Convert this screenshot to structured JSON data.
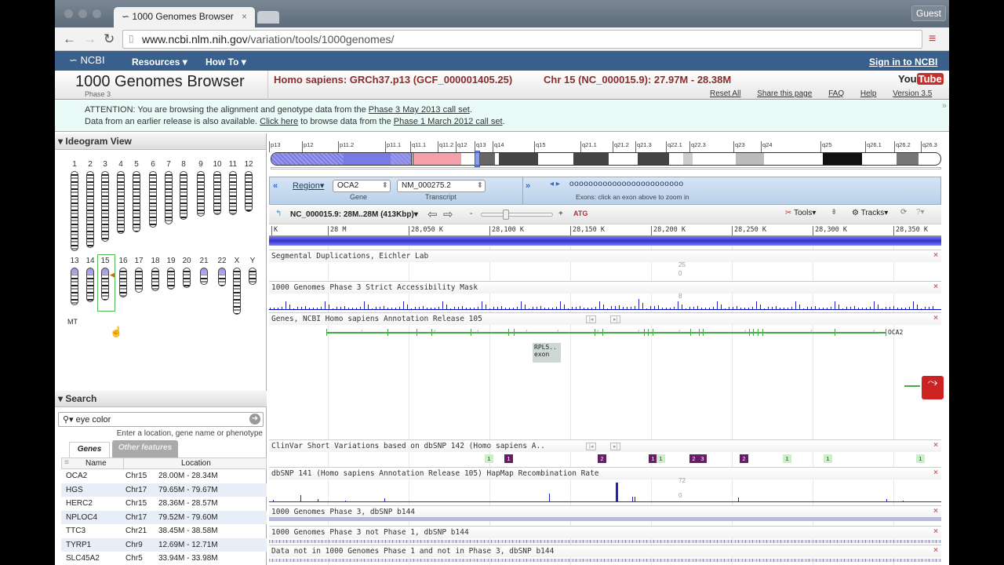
{
  "browser": {
    "tab_title": "1000 Genomes Browser",
    "url_host": "www.ncbi.nlm.nih.gov",
    "url_path": "/variation/tools/1000genomes/",
    "guest": "Guest"
  },
  "ncbi": {
    "logo": "NCBI",
    "resources": "Resources",
    "howto": "How To",
    "signin": "Sign in to NCBI"
  },
  "header": {
    "title": "1000 Genomes Browser",
    "subtitle": "Phase 3",
    "assembly": "Homo sapiens: GRCh37.p13 (GCF_000001405.25)",
    "region": "Chr 15 (NC_000015.9): 27.97M - 28.38M",
    "youtube": "YouTube",
    "links": [
      "Reset All",
      "Share this page",
      "FAQ",
      "Help",
      "Version 3.5"
    ]
  },
  "attention": {
    "l1a": "ATTENTION: You are browsing the alignment and genotype data from the ",
    "l1link": "Phase 3 May 2013 call set",
    "l1b": ".",
    "l2a": "Data from an earlier release is also available. ",
    "l2link1": "Click here",
    "l2b": " to browse data from the ",
    "l2link2": "Phase 1 March 2012 call set",
    "l2c": "."
  },
  "ideogram": {
    "title": "Ideogram View",
    "row1": [
      "1",
      "2",
      "3",
      "4",
      "5",
      "6",
      "7",
      "8",
      "9",
      "10",
      "11",
      "12"
    ],
    "row2": [
      "13",
      "14",
      "15",
      "16",
      "17",
      "18",
      "19",
      "20",
      "21",
      "22",
      "X",
      "Y"
    ],
    "mt": "MT",
    "selected": "15"
  },
  "search": {
    "title": "Search",
    "value": "eye color",
    "hint": "Enter a location, gene name or phenotype",
    "tabs": [
      "Genes",
      "Other features"
    ],
    "columns": [
      "Name",
      "Location"
    ],
    "rows": [
      [
        "OCA2",
        "Chr15",
        "28.00M - 28.34M"
      ],
      [
        "HGS",
        "Chr17",
        "79.65M - 79.67M"
      ],
      [
        "HERC2",
        "Chr15",
        "28.36M - 28.57M"
      ],
      [
        "NPLOC4",
        "Chr17",
        "79.52M - 79.60M"
      ],
      [
        "TTC3",
        "Chr21",
        "38.45M - 38.58M"
      ],
      [
        "TYRP1",
        "Chr9",
        "12.69M - 12.71M"
      ],
      [
        "SLC45A2",
        "Chr5",
        "33.94M - 33.98M"
      ]
    ]
  },
  "cytobands": [
    "p13",
    "p12",
    "p11.2",
    "p11.1",
    "q11.1",
    "q11.2",
    "q12",
    "q13",
    "q14",
    "q15",
    "q21.1",
    "q21.2",
    "q21.3",
    "q22.1",
    "q22.3",
    "q23",
    "q24",
    "q25",
    "q26.1",
    "q26.2",
    "q26.3"
  ],
  "region": {
    "mode": "Region",
    "gene": "OCA2",
    "gene_label": "Gene",
    "transcript": "NM_000275.2",
    "transcript_label": "Transcript",
    "exons_hint": "Exons: click an exon above to zoom in",
    "exon_count": 24
  },
  "viewer": {
    "location": "NC_000015.9: 28M..28M (413Kbp)",
    "tools": "Tools",
    "tracks": "Tracks",
    "ruler": [
      "K",
      "28 M",
      "28,050 K",
      "28,100 K",
      "28,150 K",
      "28,200 K",
      "28,250 K",
      "28,300 K",
      "28,350 K"
    ]
  },
  "tracks": [
    {
      "title": "Segmental Duplications, Eichler Lab",
      "ymax": "25",
      "ymin": "0"
    },
    {
      "title": "1000 Genomes Phase 3 Strict Accessibility Mask",
      "ymax": "8"
    },
    {
      "title": "Genes, NCBI Homo sapiens Annotation Release 105",
      "gene": "OCA2",
      "popup1": "RPL5..",
      "popup2": "exon"
    },
    {
      "title": "ClinVar Short Variations based on dbSNP 142 (Homo sapiens A..",
      "badges": [
        "1",
        "1",
        "2",
        "1",
        "1",
        "2",
        "3",
        "2",
        "1",
        "1",
        "1"
      ]
    },
    {
      "title": "dbSNP 141 (Homo sapiens Annotation Release 105) HapMap Recombination Rate",
      "ymax": "72",
      "ymin": "0"
    },
    {
      "title": "1000 Genomes Phase 3, dbSNP b144"
    },
    {
      "title": "1000 Genomes Phase 3 not Phase 1, dbSNP b144"
    },
    {
      "title": "Data not in 1000 Genomes Phase 1 and not in Phase 3, dbSNP b144"
    }
  ],
  "colors": {
    "ncbi_blue": "#39608c",
    "accent_red": "#8b2d2d",
    "gene_green": "#3a8a3a",
    "clinvar_purple": "#6b1a6b",
    "clinvar_green": "#c9f0c9"
  }
}
